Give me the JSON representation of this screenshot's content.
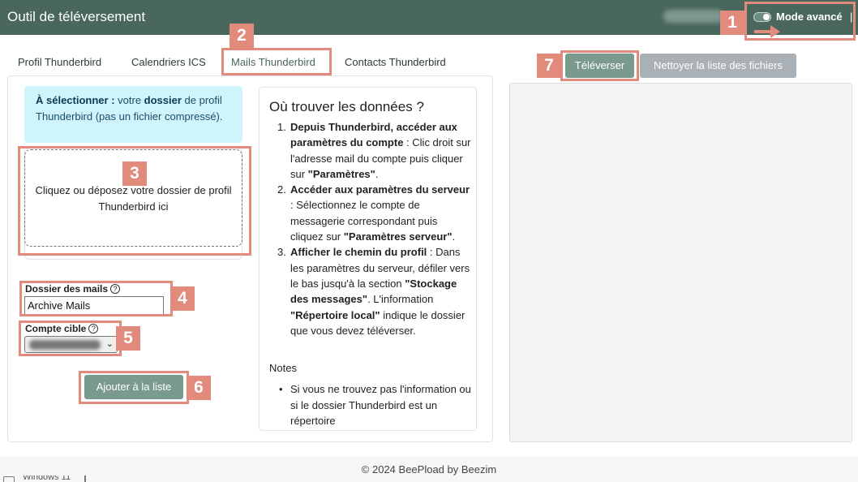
{
  "header": {
    "title": "Outil de téléversement",
    "mode_label": "Mode avancé",
    "separator": "|"
  },
  "tabs": [
    {
      "label": "Profil Thunderbird",
      "active": false
    },
    {
      "label": "Calendriers ICS",
      "active": false
    },
    {
      "label": "Mails Thunderbird",
      "active": true
    },
    {
      "label": "Contacts Thunderbird",
      "active": false
    }
  ],
  "info_box": {
    "prefix_bold": "À sélectionner :",
    "text1": " votre ",
    "bold2": "dossier",
    "text2": " de profil Thunderbird (pas un fichier compressé)."
  },
  "drop_zone": {
    "text": "Cliquez ou déposez votre dossier de profil Thunderbird ici"
  },
  "form": {
    "mail_folder_label": "Dossier des mails",
    "mail_folder_value": "Archive Mails",
    "target_account_label": "Compte cible",
    "help_glyph": "?",
    "add_button": "Ajouter à la liste",
    "select_chevron": "⌄"
  },
  "help": {
    "title": "Où trouver les données ?",
    "steps": [
      {
        "number": "1.",
        "bold": "Depuis Thunderbird, accéder aux paramètres du compte",
        "text1": " : Clic droit sur l'adresse mail du compte puis cliquer sur ",
        "bold2": "\"Paramètres\"",
        "text2": "."
      },
      {
        "number": "2.",
        "bold": "Accéder aux paramètres du serveur",
        "text1": " : Sélectionnez le compte de messagerie correspondant puis cliquez sur ",
        "bold2": "\"Paramètres serveur\"",
        "text2": "."
      },
      {
        "number": "3.",
        "bold": "Afficher le chemin du profil",
        "text1": " : Dans les paramètres du serveur, défiler vers le bas jusqu'à la section ",
        "bold2": "\"Stockage des messages\"",
        "text2": ". L'information ",
        "bold3": "\"Répertoire local\"",
        "text3": " indique le dossier que vous devez téléverser."
      }
    ],
    "notes_label": "Notes",
    "notes_bullet": "•",
    "note1": "Si vous ne trouvez pas l'information ou si le dossier Thunderbird est un répertoire"
  },
  "actions": {
    "upload_button": "Téléverser",
    "clear_button": "Nettoyer la liste des fichiers"
  },
  "annotations": [
    "1",
    "2",
    "3",
    "4",
    "5",
    "6",
    "7"
  ],
  "footer": {
    "text": "© 2024 BeePload by Beezim"
  },
  "taskbar": {
    "text": "Windows 11"
  },
  "colors": {
    "header_bg": "#4a675d",
    "annotation": "#e28a7c",
    "info_bg": "#cff4fc",
    "primary_button": "#7a9a8e",
    "secondary_button": "#a9b0b6"
  }
}
